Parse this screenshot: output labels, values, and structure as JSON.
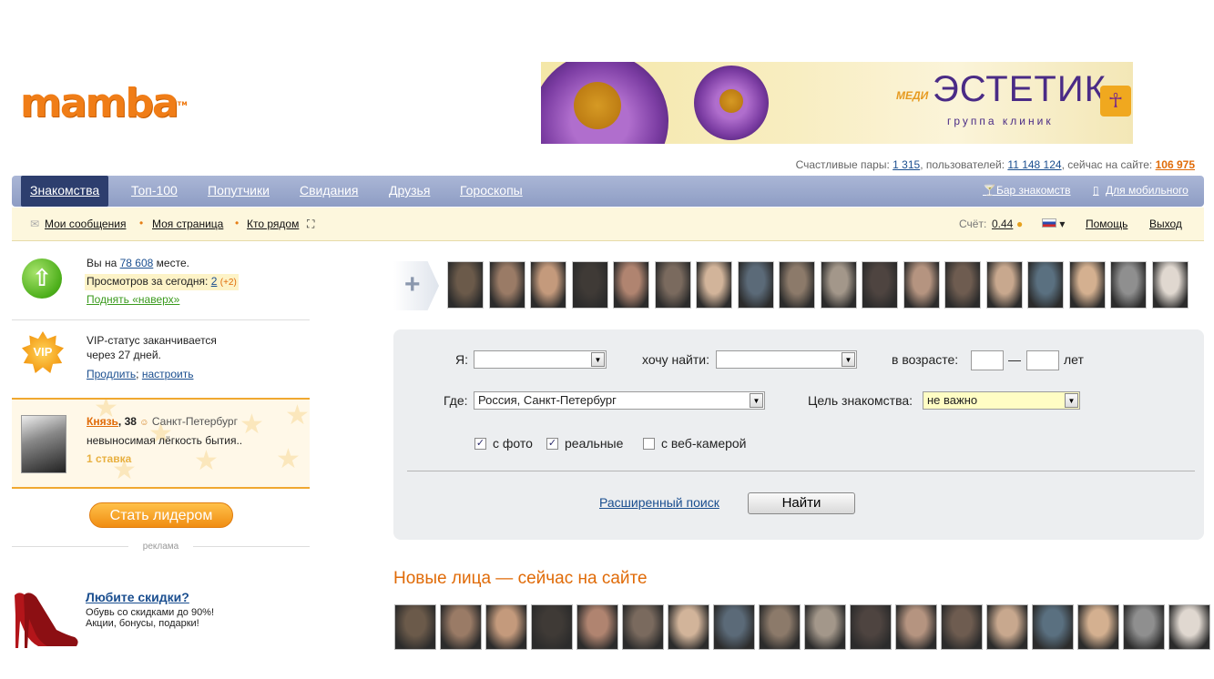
{
  "logo": {
    "text": "mamba",
    "tm": "тм"
  },
  "banner": {
    "medi": "МЕДИ",
    "brand": "ЭСТЕТИК",
    "sub": "группа клиник",
    "logo_glyph": "☥"
  },
  "stats": {
    "pairs_label": "Счастливые пары:",
    "pairs": "1 315",
    "users_label": ", пользователей:",
    "users": "11 148 124",
    "online_label": ", сейчас на сайте:",
    "online": "106 975"
  },
  "nav": {
    "items": [
      "Знакомства",
      "Топ-100",
      "Попутчики",
      "Свидания",
      "Друзья",
      "Гороскопы"
    ],
    "bar": "Бар знакомств",
    "mobile": "Для мобильного",
    "bar_icon": "cocktail-icon",
    "mobile_icon": "phone-icon"
  },
  "subnav": {
    "messages": "Мои сообщения",
    "my_page": "Моя страница",
    "nearby": "Кто рядом",
    "account_label": "Счёт:",
    "account_value": "0.44",
    "help": "Помощь",
    "logout": "Выход"
  },
  "sidebar": {
    "rank_prefix": "Вы на",
    "rank_value": "78 608",
    "rank_suffix": "месте.",
    "views_label": "Просмотров за сегодня:",
    "views_value": "2",
    "views_delta": "(+2)",
    "raise_link": "Поднять «наверх»",
    "vip_icon": "VIP",
    "vip_line1": "VIP-статус заканчивается",
    "vip_line2": "через 27 дней.",
    "vip_extend": "Продлить",
    "vip_sep": ";",
    "vip_setup": "настроить",
    "leader_name": "Князь",
    "leader_age": ", 38",
    "leader_city": "Санкт-Петербург",
    "leader_status": "невыносимая лёгкость бытия..",
    "leader_bids": "1 ставка",
    "leader_button": "Стать лидером",
    "ad_label": "реклама",
    "ad_title": "Любите скидки?",
    "ad_line1": "Обувь со скидками до 90%!",
    "ad_line2": "Акции, бонусы, подарки!"
  },
  "search": {
    "i_label": "Я:",
    "i_value": "",
    "want_label": "хочу найти:",
    "want_value": "",
    "age_label": "в возрасте:",
    "age_from": "",
    "age_dash": "—",
    "age_to": "",
    "age_suffix": "лет",
    "where_label": "Где:",
    "where_value": "Россия, Санкт-Петербург",
    "goal_label": "Цель знакомства:",
    "goal_value": "не важно",
    "with_photo": "с фото",
    "real": "реальные",
    "webcam": "с веб-камерой",
    "with_photo_checked": true,
    "real_checked": true,
    "webcam_checked": false,
    "advanced": "Расширенный поиск",
    "find": "Найти"
  },
  "new_faces_title": "Новые лица — сейчас на сайте",
  "colors": {
    "accent": "#f07d17",
    "link": "#1a4e8f",
    "nav": "#8e9dc4",
    "nav_active": "#2d3e6e"
  }
}
